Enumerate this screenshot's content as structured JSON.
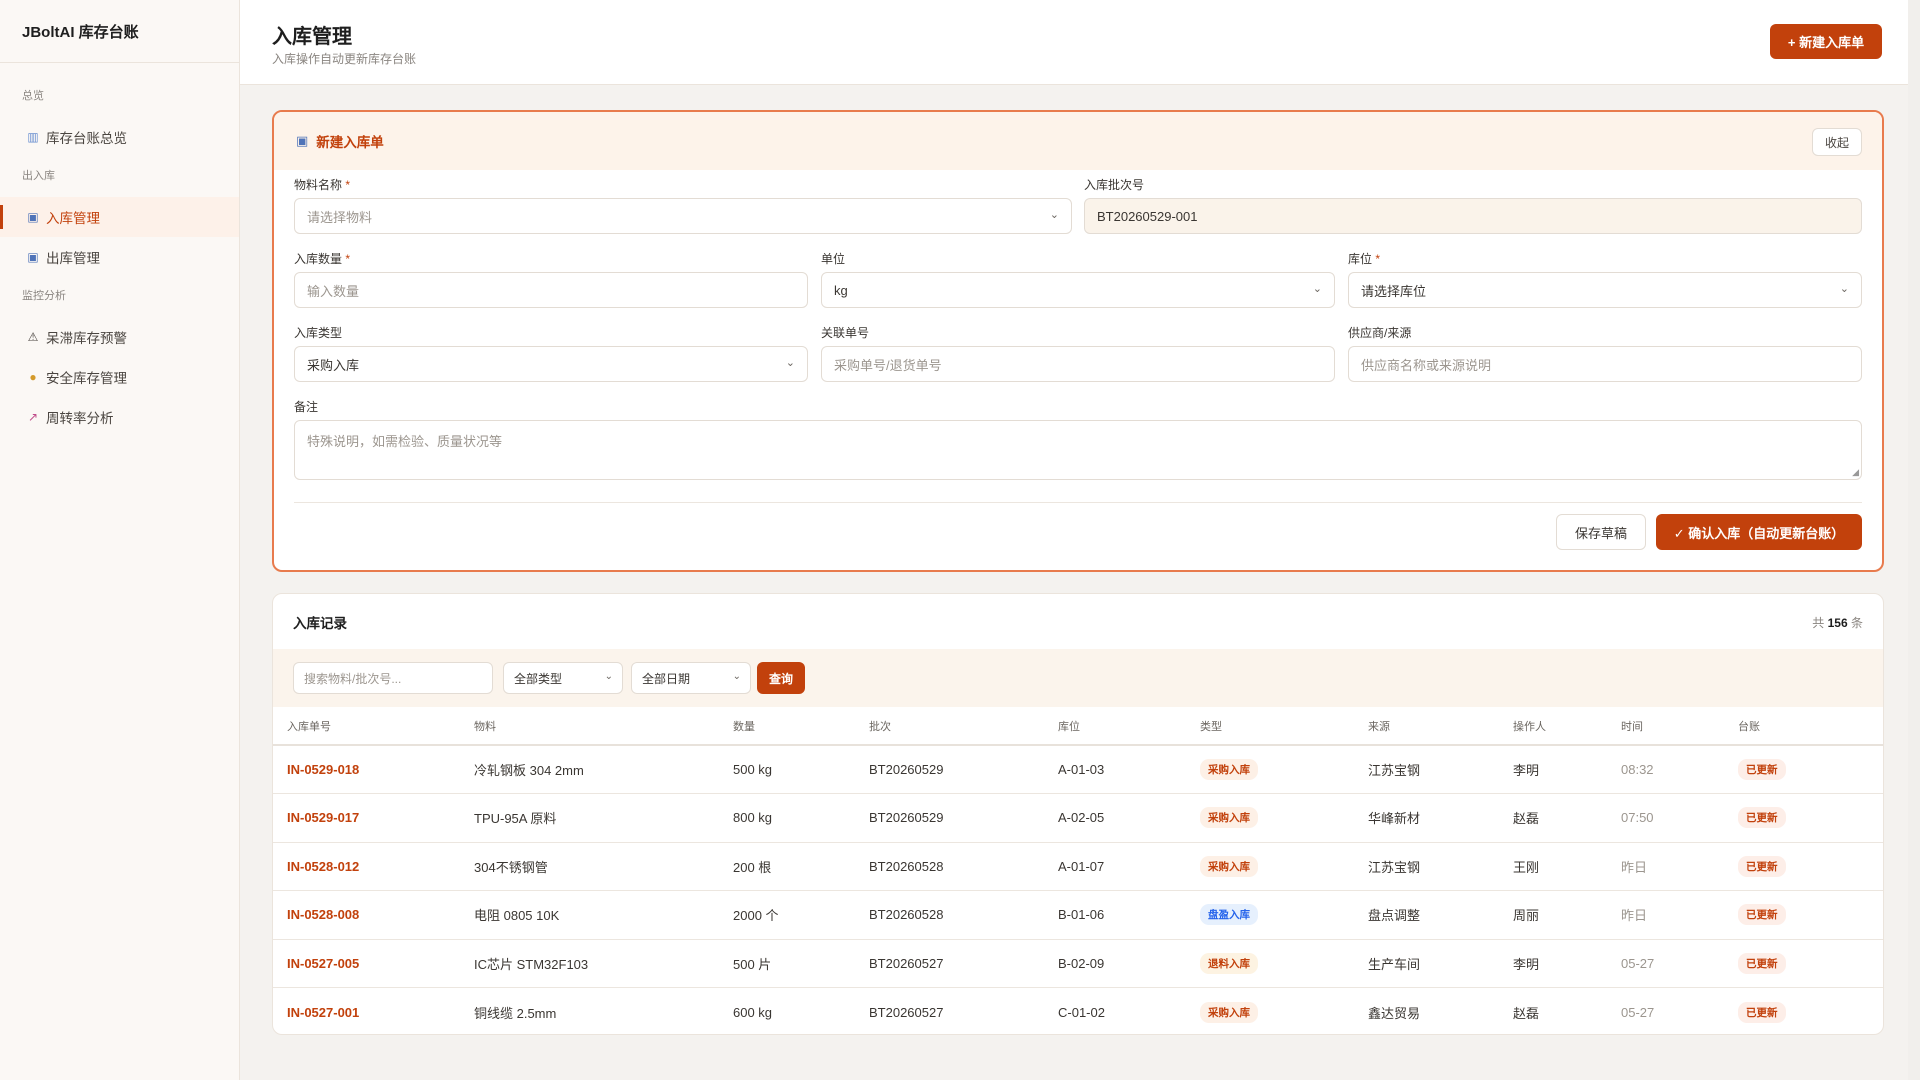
{
  "app": {
    "brand": "JBoltAI 库存台账"
  },
  "sidebar": {
    "groups": [
      {
        "label": "总览",
        "items": [
          {
            "label": "库存台账总览",
            "icon": "bar-chart-icon"
          }
        ]
      },
      {
        "label": "出入库",
        "items": [
          {
            "label": "入库管理",
            "icon": "package-icon",
            "active": true
          },
          {
            "label": "出库管理",
            "icon": "package-icon"
          }
        ]
      },
      {
        "label": "监控分析",
        "items": [
          {
            "label": "呆滞库存预警",
            "icon": "warning-icon"
          },
          {
            "label": "安全库存管理",
            "icon": "money-bag-icon"
          },
          {
            "label": "周转率分析",
            "icon": "line-chart-icon"
          }
        ]
      }
    ]
  },
  "header": {
    "title": "入库管理",
    "subtitle": "入库操作自动更新库存台账",
    "new_button": "+ 新建入库单"
  },
  "form": {
    "title": "新建入库单",
    "collapse": "收起",
    "material": {
      "label": "物料名称",
      "required": "*",
      "placeholder": "请选择物料"
    },
    "batch": {
      "label": "入库批次号",
      "value": "BT20260529-001"
    },
    "quantity": {
      "label": "入库数量",
      "required": "*",
      "placeholder": "输入数量"
    },
    "unit": {
      "label": "单位",
      "value": "kg"
    },
    "location": {
      "label": "库位",
      "required": "*",
      "placeholder": "请选择库位"
    },
    "type": {
      "label": "入库类型",
      "value": "采购入库"
    },
    "ref": {
      "label": "关联单号",
      "placeholder": "采购单号/退货单号"
    },
    "supplier": {
      "label": "供应商/来源",
      "placeholder": "供应商名称或来源说明"
    },
    "note": {
      "label": "备注",
      "placeholder": "特殊说明，如需检验、质量状况等"
    },
    "draft_button": "保存草稿",
    "confirm_button": "✓ 确认入库（自动更新台账）"
  },
  "records": {
    "title": "入库记录",
    "count_prefix": "共",
    "count": "156",
    "count_suffix": "条",
    "search_placeholder": "搜索物料/批次号...",
    "type_filter": "全部类型",
    "date_filter": "全部日期",
    "query_button": "查询",
    "columns": [
      "入库单号",
      "物料",
      "数量",
      "批次",
      "库位",
      "类型",
      "来源",
      "操作人",
      "时间",
      "台账"
    ],
    "rows": [
      {
        "id": "IN-0529-018",
        "material": "冷轧钢板 304 2mm",
        "qty": "500 kg",
        "batch": "BT20260529",
        "loc": "A-01-03",
        "type": "采购入库",
        "type_class": "purchase",
        "source": "江苏宝钢",
        "operator": "李明",
        "time": "08:32",
        "status": "已更新"
      },
      {
        "id": "IN-0529-017",
        "material": "TPU-95A 原料",
        "qty": "800 kg",
        "batch": "BT20260529",
        "loc": "A-02-05",
        "type": "采购入库",
        "type_class": "purchase",
        "source": "华峰新材",
        "operator": "赵磊",
        "time": "07:50",
        "status": "已更新"
      },
      {
        "id": "IN-0528-012",
        "material": "304不锈钢管",
        "qty": "200 根",
        "batch": "BT20260528",
        "loc": "A-01-07",
        "type": "采购入库",
        "type_class": "purchase",
        "source": "江苏宝钢",
        "operator": "王刚",
        "time": "昨日",
        "status": "已更新"
      },
      {
        "id": "IN-0528-008",
        "material": "电阻 0805 10K",
        "qty": "2000 个",
        "batch": "BT20260528",
        "loc": "B-01-06",
        "type": "盘盈入库",
        "type_class": "stock",
        "source": "盘点调整",
        "operator": "周丽",
        "time": "昨日",
        "status": "已更新"
      },
      {
        "id": "IN-0527-005",
        "material": "IC芯片 STM32F103",
        "qty": "500 片",
        "batch": "BT20260527",
        "loc": "B-02-09",
        "type": "退料入库",
        "type_class": "return",
        "source": "生产车间",
        "operator": "李明",
        "time": "05-27",
        "status": "已更新"
      },
      {
        "id": "IN-0527-001",
        "material": "铜线缆 2.5mm",
        "qty": "600 kg",
        "batch": "BT20260527",
        "loc": "C-01-02",
        "type": "采购入库",
        "type_class": "purchase",
        "source": "鑫达贸易",
        "operator": "赵磊",
        "time": "05-27",
        "status": "已更新"
      }
    ]
  },
  "colors": {
    "accent": "#c2410c",
    "accent_border": "#e87b4d",
    "tag_blue": "#2563eb"
  }
}
